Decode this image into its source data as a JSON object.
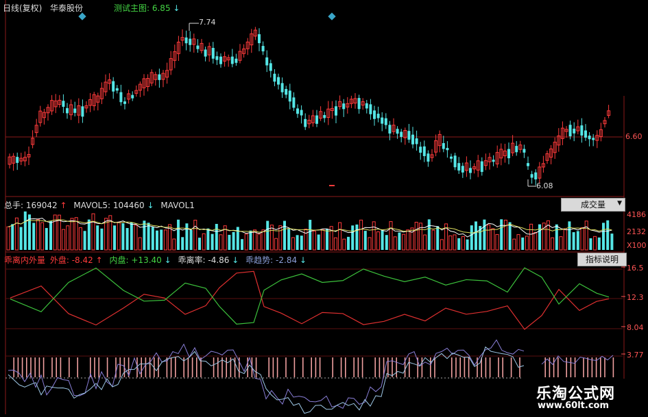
{
  "top": {
    "title": "日线(复权)",
    "stock": "华泰股份",
    "indicator": "测试主图: 6.85",
    "indicator_arrow": "↓"
  },
  "price_panel": {
    "high_label": "7.74",
    "low_label": "6.08",
    "axis_label": "6.60"
  },
  "volume_panel": {
    "total_label": "总手:",
    "total_value": "169042",
    "total_arrow": "↑",
    "mavol5_label": "MAVOL5:",
    "mavol5_value": "104460",
    "mavol5_arrow": "↓",
    "mavol10_label": "MAVOL1",
    "dropdown_label": "成交量",
    "axis": [
      "4186",
      "2132",
      "X100"
    ]
  },
  "indicator_panel": {
    "name": "乖离内外量",
    "outer_label": "外盘:",
    "outer_value": "-8.42",
    "outer_arrow": "↑",
    "inner_label": "内盘:",
    "inner_value": "+13.40",
    "inner_arrow": "↓",
    "deviation_label": "乖离率:",
    "deviation_value": "-4.86",
    "deviation_arrow": "↓",
    "trend_label": "乖趋势:",
    "trend_value": "-2.84",
    "trend_arrow": "↓",
    "explain_button": "指标说明",
    "axis": [
      "16.5",
      "12.3",
      "8.04",
      "3.77"
    ]
  },
  "watermark": {
    "name": "乐淘公式网",
    "url": "www.60lt.com"
  },
  "colors": {
    "up": "#ff3b3b",
    "down": "#55e6e6",
    "outer_line": "#e03030",
    "inner_line": "#3cc23c",
    "deviation_line": "#8a7fd8",
    "trend_line": "#9fc9e8",
    "text_white": "#dddddd",
    "text_green": "#44d444",
    "axis_red": "#ff5555"
  }
}
